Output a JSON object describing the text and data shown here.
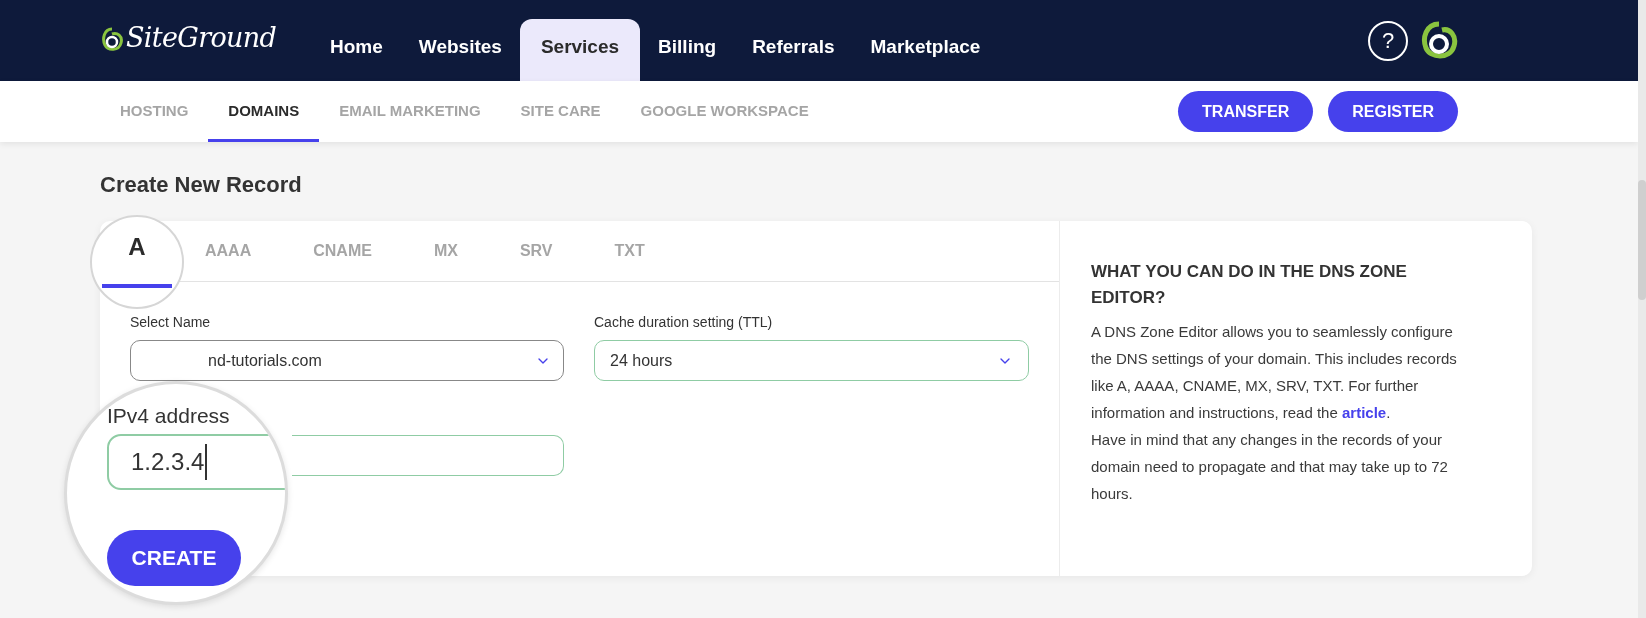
{
  "header": {
    "logo": "SiteGround",
    "nav": [
      {
        "label": "Home",
        "selected": false
      },
      {
        "label": "Websites",
        "selected": false
      },
      {
        "label": "Services",
        "selected": true
      },
      {
        "label": "Billing",
        "selected": false
      },
      {
        "label": "Referrals",
        "selected": false
      },
      {
        "label": "Marketplace",
        "selected": false
      }
    ],
    "help": "?"
  },
  "subnav": {
    "tabs": [
      {
        "label": "HOSTING",
        "selected": false
      },
      {
        "label": "DOMAINS",
        "selected": true
      },
      {
        "label": "EMAIL MARKETING",
        "selected": false
      },
      {
        "label": "SITE CARE",
        "selected": false
      },
      {
        "label": "GOOGLE WORKSPACE",
        "selected": false
      }
    ],
    "buttons": [
      "TRANSFER",
      "REGISTER"
    ]
  },
  "page_title": "Create New Record",
  "record_tabs": [
    {
      "label": "A",
      "selected": true,
      "kind": "magnified"
    },
    {
      "label": "AAAA",
      "selected": false,
      "kind": "plain"
    },
    {
      "label": "CNAME",
      "selected": false,
      "kind": "plain"
    },
    {
      "label": "MX",
      "selected": false,
      "kind": "plain"
    },
    {
      "label": "SRV",
      "selected": false,
      "kind": "plain"
    },
    {
      "label": "TXT",
      "selected": false,
      "kind": "plain"
    }
  ],
  "select_name": {
    "label": "Select Name",
    "value": "nd-tutorials.com"
  },
  "ttl": {
    "label": "Cache duration setting (TTL)",
    "value": "24 hours"
  },
  "magnifier": {
    "label": "IPv4 address",
    "value": "1.2.3.4",
    "button": "CREATE"
  },
  "info": {
    "title": "WHAT YOU CAN DO IN THE DNS ZONE EDITOR?",
    "text": "A DNS Zone Editor allows you to seamlessly configure the DNS settings of your domain. This includes records like A, AAAA, CNAME, MX, SRV, TXT. For further information and instructions, read the",
    "link": "article",
    "after": ".",
    "text2": "Have in mind that any changes in the records of your domain need to propagate and that may take up to 72 hours."
  }
}
